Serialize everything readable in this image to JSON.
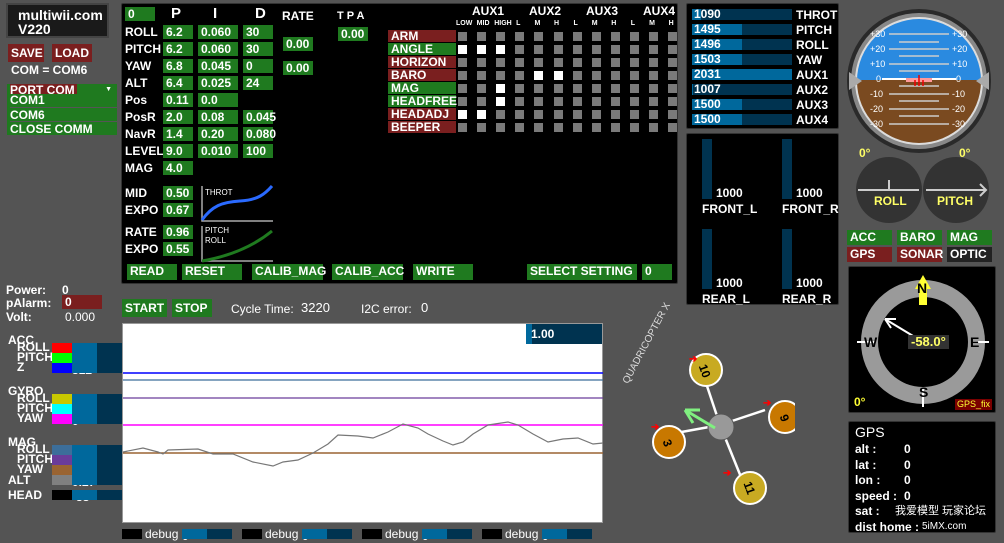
{
  "app": {
    "logo_line1": "multiwii.com",
    "logo_line2": "V220"
  },
  "conn": {
    "save": "SAVE",
    "load": "LOAD",
    "com_status": "COM = COM6",
    "port_label": "PORT COM",
    "ports": [
      "COM1",
      "COM6",
      "CLOSE COMM"
    ]
  },
  "pid": {
    "profile": "0",
    "col_p": "P",
    "col_i": "I",
    "col_d": "D",
    "col_rate": "RATE",
    "col_tpa": "T P A",
    "rows": [
      {
        "name": "ROLL",
        "p": "6.2",
        "i": "0.060",
        "d": "30"
      },
      {
        "name": "PITCH",
        "p": "6.2",
        "i": "0.060",
        "d": "30"
      },
      {
        "name": "YAW",
        "p": "6.8",
        "i": "0.045",
        "d": "0"
      },
      {
        "name": "ALT",
        "p": "6.4",
        "i": "0.025",
        "d": "24"
      },
      {
        "name": "Pos",
        "p": "0.11",
        "i": "0.0",
        "d": ""
      },
      {
        "name": "PosR",
        "p": "2.0",
        "i": "0.08",
        "d": "0.045"
      },
      {
        "name": "NavR",
        "p": "1.4",
        "i": "0.20",
        "d": "0.080"
      },
      {
        "name": "LEVEL",
        "p": "9.0",
        "i": "0.010",
        "d": "100"
      },
      {
        "name": "MAG",
        "p": "4.0",
        "i": "",
        "d": ""
      }
    ],
    "rate_rollpitch": "0.00",
    "rate_yaw": "0.00",
    "tpa": "0.00",
    "throt_mid_label": "MID",
    "throt_mid": "0.50",
    "throt_expo_label": "EXPO",
    "throt_expo": "0.67",
    "rc_rate_label": "RATE",
    "rc_rate": "0.96",
    "rc_expo_label": "EXPO",
    "rc_expo": "0.55",
    "throt_curve_label": "THROT",
    "pr_curve_label1": "PITCH",
    "pr_curve_label2": "ROLL"
  },
  "buttons": {
    "read": "READ",
    "reset": "RESET",
    "calib_mag": "CALIB_MAG",
    "calib_acc": "CALIB_ACC",
    "write": "WRITE",
    "select_setting": "SELECT SETTING",
    "setting_value": "0"
  },
  "aux": {
    "headers": [
      "AUX1",
      "AUX2",
      "AUX3",
      "AUX4"
    ],
    "sub": [
      "LOW",
      "MID",
      "HIGH",
      "L",
      "M",
      "H",
      "L",
      "M",
      "H",
      "L",
      "M",
      "H"
    ],
    "modes": [
      {
        "name": "ARM",
        "active": false,
        "states": [
          0,
          0,
          0,
          0,
          0,
          0,
          0,
          0,
          0,
          0,
          0,
          0
        ]
      },
      {
        "name": "ANGLE",
        "active": true,
        "states": [
          1,
          1,
          1,
          0,
          0,
          0,
          0,
          0,
          0,
          0,
          0,
          0
        ]
      },
      {
        "name": "HORIZON",
        "active": false,
        "states": [
          0,
          0,
          0,
          0,
          0,
          0,
          0,
          0,
          0,
          0,
          0,
          0
        ]
      },
      {
        "name": "BARO",
        "active": false,
        "states": [
          0,
          0,
          0,
          0,
          1,
          1,
          0,
          0,
          0,
          0,
          0,
          0
        ]
      },
      {
        "name": "MAG",
        "active": true,
        "states": [
          0,
          0,
          1,
          0,
          0,
          0,
          0,
          0,
          0,
          0,
          0,
          0
        ]
      },
      {
        "name": "HEADFREE",
        "active": true,
        "states": [
          0,
          0,
          1,
          0,
          0,
          0,
          0,
          0,
          0,
          0,
          0,
          0
        ]
      },
      {
        "name": "HEADADJ",
        "active": false,
        "states": [
          1,
          1,
          0,
          0,
          0,
          0,
          0,
          0,
          0,
          0,
          0,
          0
        ]
      },
      {
        "name": "BEEPER",
        "active": false,
        "states": [
          0,
          0,
          0,
          0,
          0,
          0,
          0,
          0,
          0,
          0,
          0,
          0
        ]
      }
    ]
  },
  "rc": [
    {
      "name": "THROT",
      "value": "1090"
    },
    {
      "name": "PITCH",
      "value": "1495"
    },
    {
      "name": "ROLL",
      "value": "1496"
    },
    {
      "name": "YAW",
      "value": "1503"
    },
    {
      "name": "AUX1",
      "value": "2031"
    },
    {
      "name": "AUX2",
      "value": "1007"
    },
    {
      "name": "AUX3",
      "value": "1500"
    },
    {
      "name": "AUX4",
      "value": "1500"
    }
  ],
  "motors": [
    {
      "name": "FRONT_L",
      "value": "1000"
    },
    {
      "name": "FRONT_R",
      "value": "1000"
    },
    {
      "name": "REAR_L",
      "value": "1000"
    },
    {
      "name": "REAR_R",
      "value": "1000"
    }
  ],
  "horizon": {
    "ticks": [
      "+30",
      "+20",
      "+10",
      "0",
      "-10",
      "-20",
      "-30"
    ]
  },
  "attitude": {
    "roll_value": "0°",
    "pitch_value": "0°",
    "roll_label": "ROLL",
    "pitch_label": "PITCH"
  },
  "sensors": [
    {
      "name": "ACC",
      "on": true
    },
    {
      "name": "BARO",
      "on": true
    },
    {
      "name": "MAG",
      "on": true
    },
    {
      "name": "GPS",
      "on": false
    },
    {
      "name": "SONAR",
      "on": false
    },
    {
      "name": "OPTIC",
      "on": null
    }
  ],
  "compass": {
    "n": "N",
    "s": "S",
    "e": "E",
    "w": "W",
    "heading": "-58.0°",
    "heading_deg": -58,
    "alt_angle": "0°",
    "gps_fix": "GPS_fix"
  },
  "gps": {
    "title": "GPS",
    "rows": [
      {
        "k": "alt  :",
        "v": "0"
      },
      {
        "k": "lat  :",
        "v": "0"
      },
      {
        "k": "lon  :",
        "v": "0"
      },
      {
        "k": "speed :",
        "v": "0"
      },
      {
        "k": "sat  :",
        "v": "我爱模型 玩家论坛"
      },
      {
        "k": "dist home :",
        "v": "5iMX.com"
      }
    ]
  },
  "power": {
    "power_label": "Power:",
    "power": "0",
    "palarm_label": "pAlarm:",
    "palarm": "0",
    "volt_label": "Volt:",
    "volt": "0.000"
  },
  "graph": {
    "start": "START",
    "stop": "STOP",
    "cycle_label": "Cycle Time:",
    "cycle": "3220",
    "i2c_label": "I2C error:",
    "i2c": "0",
    "scale": "1.00"
  },
  "legend": [
    {
      "group": "ACC",
      "items": [
        {
          "name": "ROLL",
          "value": "-1",
          "color": "#ff0000"
        },
        {
          "name": "PITCH",
          "value": "5",
          "color": "#00ff00"
        },
        {
          "name": "Z",
          "value": "512",
          "color": "#0000ff"
        }
      ]
    },
    {
      "group": "GYRO",
      "items": [
        {
          "name": "ROLL",
          "value": "0",
          "color": "#c8c800"
        },
        {
          "name": "PITCH",
          "value": "0",
          "color": "#00ffff"
        },
        {
          "name": "YAW",
          "value": "0",
          "color": "#ff00ff"
        }
      ]
    },
    {
      "group": "MAG",
      "items": [
        {
          "name": "ROLL",
          "value": "224",
          "color": "#3c6e9a"
        },
        {
          "name": "PITCH",
          "value": "136",
          "color": "#6a3c9a"
        },
        {
          "name": "YAW",
          "value": "-144",
          "color": "#9a6432"
        }
      ]
    }
  ],
  "alt": {
    "label": "ALT",
    "value": "0.27",
    "color": "#808080"
  },
  "head": {
    "label": "HEAD",
    "value": "-58",
    "color": "#000000"
  },
  "debug": [
    {
      "label": "debug",
      "value": "0"
    },
    {
      "label": "debug",
      "value": "0"
    },
    {
      "label": "debug",
      "value": "0"
    },
    {
      "label": "debug",
      "value": "0"
    }
  ],
  "quad": {
    "type_label": "QUADRICOPTER X",
    "motors": [
      "10",
      "9",
      "3",
      "11"
    ]
  }
}
